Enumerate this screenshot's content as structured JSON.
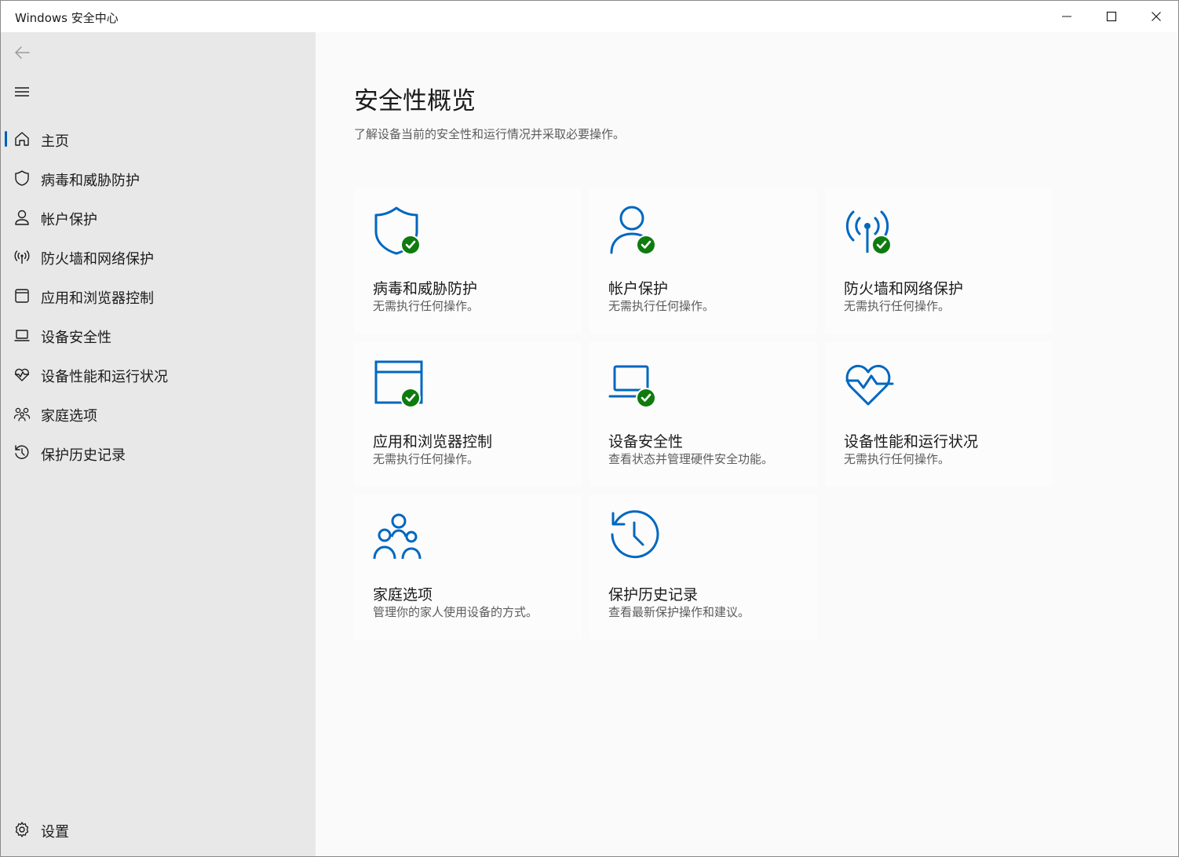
{
  "window": {
    "title": "Windows 安全中心"
  },
  "sidebar": {
    "items": [
      {
        "label": "主页",
        "icon": "home-icon",
        "active": true
      },
      {
        "label": "病毒和威胁防护",
        "icon": "shield-icon"
      },
      {
        "label": "帐户保护",
        "icon": "person-icon"
      },
      {
        "label": "防火墙和网络保护",
        "icon": "antenna-icon"
      },
      {
        "label": "应用和浏览器控制",
        "icon": "app-window-icon"
      },
      {
        "label": "设备安全性",
        "icon": "laptop-icon"
      },
      {
        "label": "设备性能和运行状况",
        "icon": "heart-pulse-icon"
      },
      {
        "label": "家庭选项",
        "icon": "family-icon"
      },
      {
        "label": "保护历史记录",
        "icon": "history-icon"
      }
    ],
    "settings": {
      "label": "设置",
      "icon": "gear-icon"
    }
  },
  "main": {
    "title": "安全性概览",
    "subtitle": "了解设备当前的安全性和运行情况并采取必要操作。",
    "tiles": [
      {
        "title": "病毒和威胁防护",
        "desc": "无需执行任何操作。",
        "icon": "shield-icon",
        "status": "ok"
      },
      {
        "title": "帐户保护",
        "desc": "无需执行任何操作。",
        "icon": "person-icon",
        "status": "ok"
      },
      {
        "title": "防火墙和网络保护",
        "desc": "无需执行任何操作。",
        "icon": "antenna-icon",
        "status": "ok"
      },
      {
        "title": "应用和浏览器控制",
        "desc": "无需执行任何操作。",
        "icon": "app-window-icon",
        "status": "ok"
      },
      {
        "title": "设备安全性",
        "desc": "查看状态并管理硬件安全功能。",
        "icon": "laptop-icon",
        "status": "ok"
      },
      {
        "title": "设备性能和运行状况",
        "desc": "无需执行任何操作。",
        "icon": "heart-pulse-icon",
        "status": "none"
      },
      {
        "title": "家庭选项",
        "desc": "管理你的家人使用设备的方式。",
        "icon": "family-icon",
        "status": "none"
      },
      {
        "title": "保护历史记录",
        "desc": "查看最新保护操作和建议。",
        "icon": "history-icon",
        "status": "none"
      }
    ]
  },
  "colors": {
    "accent": "#0067c0",
    "ok": "#0f7b0f",
    "sidebar": "#e8e8e8",
    "background": "#fafafa"
  }
}
